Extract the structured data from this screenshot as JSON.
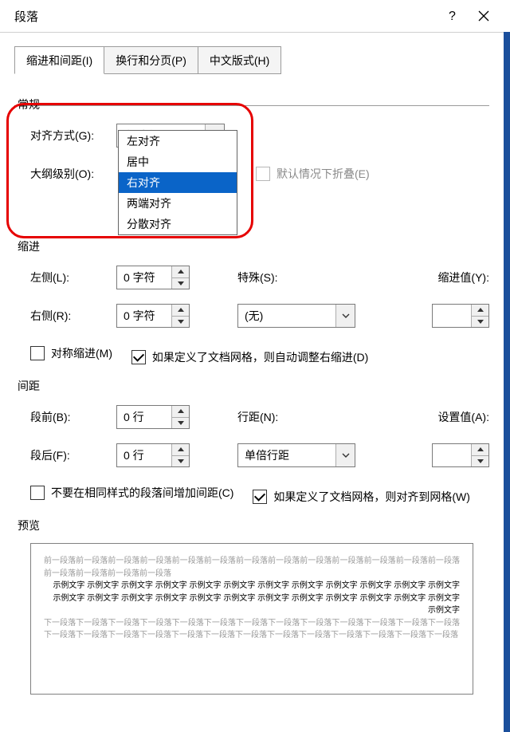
{
  "titlebar": {
    "title": "段落"
  },
  "tabs": {
    "t1": "缩进和间距(I)",
    "t2": "换行和分页(P)",
    "t3": "中文版式(H)"
  },
  "general": {
    "heading": "常规",
    "align_label": "对齐方式(G):",
    "align_value": "右对齐",
    "align_options": [
      "左对齐",
      "居中",
      "右对齐",
      "两端对齐",
      "分散对齐"
    ],
    "outline_label": "大纲级别(O):",
    "collapse_label": "默认情况下折叠(E)"
  },
  "indent": {
    "heading": "缩进",
    "left_label": "左侧(L):",
    "left_value": "0 字符",
    "right_label": "右侧(R):",
    "right_value": "0 字符",
    "special_label": "特殊(S):",
    "special_value": "(无)",
    "by_label": "缩进值(Y):",
    "mirror_label": "对称缩进(M)",
    "grid_label": "如果定义了文档网格，则自动调整右缩进(D)"
  },
  "spacing": {
    "heading": "间距",
    "before_label": "段前(B):",
    "before_value": "0 行",
    "after_label": "段后(F):",
    "after_value": "0 行",
    "line_label": "行距(N):",
    "line_value": "单倍行距",
    "at_label": "设置值(A):",
    "nosame_label": "不要在相同样式的段落间增加间距(C)",
    "snap_label": "如果定义了文档网格，则对齐到网格(W)"
  },
  "preview": {
    "heading": "预览",
    "prev_para": "前一段落前一段落前一段落前一段落前一段落前一段落前一段落前一段落前一段落前一段落前一段落前一段落前一段落前一段落前一段落前一段落前一段落",
    "sample": "示例文字 示例文字 示例文字 示例文字 示例文字 示例文字 示例文字 示例文字 示例文字 示例文字 示例文字 示例文字 示例文字 示例文字 示例文字 示例文字 示例文字 示例文字 示例文字 示例文字 示例文字 示例文字 示例文字 示例文字 示例文字",
    "next_para": "下一段落下一段落下一段落下一段落下一段落下一段落下一段落下一段落下一段落下一段落下一段落下一段落下一段落下一段落下一段落下一段落下一段落下一段落下一段落下一段落下一段落下一段落下一段落下一段落下一段落下一段落"
  }
}
